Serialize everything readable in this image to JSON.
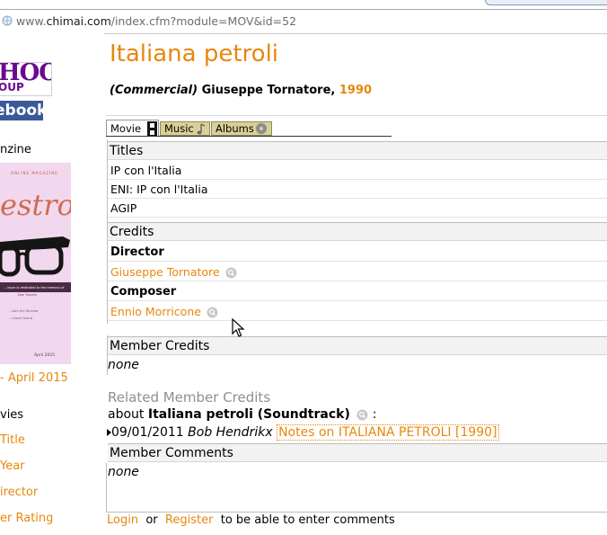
{
  "browser": {
    "url_prefix": "www.",
    "url_domain": "chimai.com",
    "url_rest": "/index.cfm?module=MOV&id=52"
  },
  "sidebar": {
    "yahoo_text": "HOO!",
    "yahoo_sub": "OUP",
    "facebook_text": "ebook",
    "magazine_label": "nzine",
    "magazine_cover": {
      "online_text": "ONLINE MAGAZINE",
      "title_text": "estro",
      "dedication": "...issue is dedicated to the memory of",
      "dedication_name": "Don Travers",
      "line1": "...with the Director",
      "line2": "...nnone Island",
      "date": "April 2015"
    },
    "issue_link": "- April 2015",
    "movies_label": "vies",
    "links": [
      "Title",
      "Year",
      "irector",
      "er Rating"
    ]
  },
  "page": {
    "title": "Italiana petroli",
    "type": "(Commercial)",
    "director": "Giuseppe Tornatore,",
    "year": "1990"
  },
  "tabs": [
    {
      "label": "Movie"
    },
    {
      "label": "Music"
    },
    {
      "label": "Albums"
    }
  ],
  "titles": {
    "heading": "Titles",
    "items": [
      "IP con l'Italia",
      "ENI: IP con l'Italia",
      "AGIP"
    ]
  },
  "credits": {
    "heading": "Credits",
    "director_role": "Director",
    "director_name": "Giuseppe Tornatore",
    "composer_role": "Composer",
    "composer_name": "Ennio Morricone"
  },
  "member_credits": {
    "heading": "Member Credits",
    "value": "none"
  },
  "related": {
    "heading": "Related Member Credits",
    "about_prefix": "about",
    "about_title": "Italiana petroli (Soundtrack)",
    "about_suffix": ":",
    "entry_date": "09/01/2011",
    "entry_author": "Bob Hendrikx",
    "entry_link": "Notes on ITALIANA PETROLI [1990]"
  },
  "member_comments": {
    "heading": "Member Comments",
    "value": "none"
  },
  "footer": {
    "login": "Login",
    "or": "or",
    "register": "Register",
    "suffix": "to be able to enter comments"
  },
  "colors": {
    "accent": "#e8870d",
    "tab_inactive": "#d9d098",
    "facebook": "#3b5998",
    "yahoo": "#6b0a8f"
  }
}
